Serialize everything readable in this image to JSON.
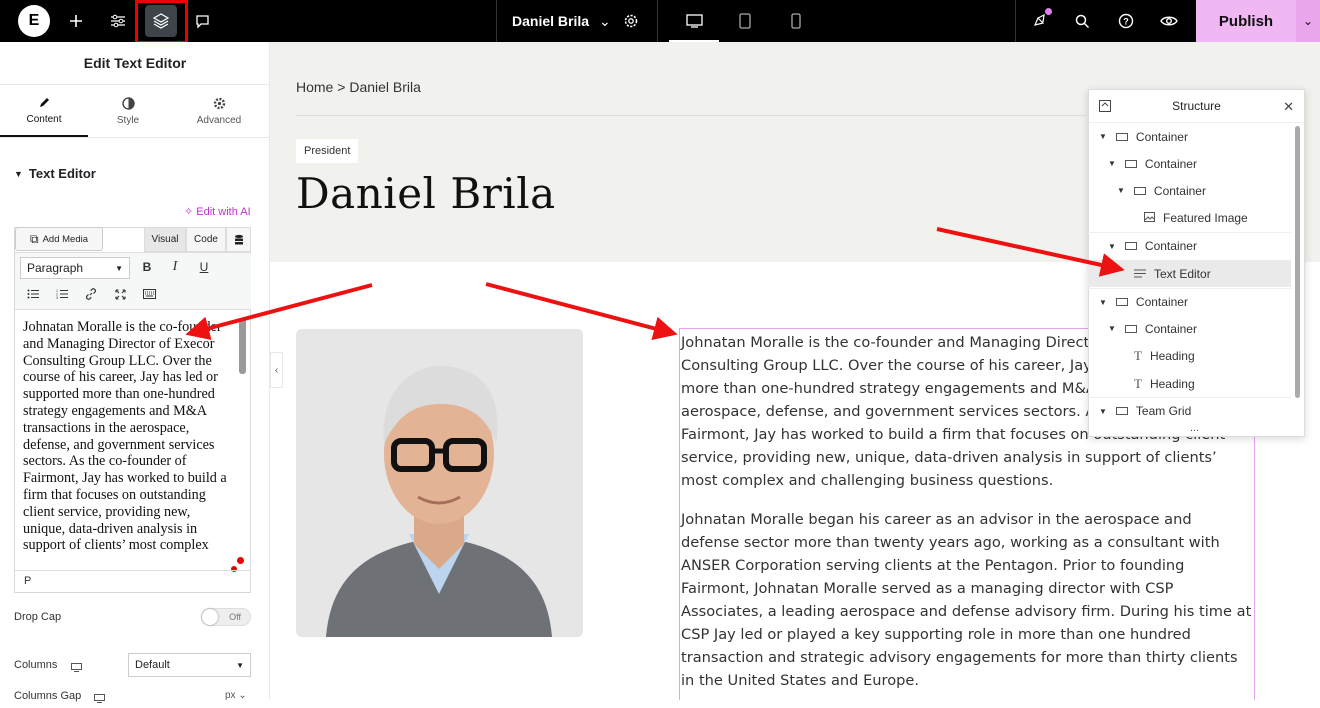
{
  "topbar": {
    "document_name": "Daniel Brila",
    "publish_label": "Publish"
  },
  "panel": {
    "title": "Edit Text Editor",
    "tabs": [
      {
        "label": "Content"
      },
      {
        "label": "Style"
      },
      {
        "label": "Advanced"
      }
    ],
    "section_title": "Text Editor",
    "edit_ai": "Edit with AI",
    "add_media": "Add Media",
    "visual_tab": "Visual",
    "code_tab": "Code",
    "paragraph_format": "Paragraph",
    "editor_text": "Johnatan Moralle is the co-founder and Managing Director of Execor Consulting Group LLC. Over the course of his career, Jay has led or supported more than one-hundred strategy engagements and M&A transactions in the aerospace, defense, and government services sectors. As the co-founder of Fairmont, Jay has worked to build a firm that focuses on outstanding client service, providing new, unique, data-driven analysis in support of clients’ most complex",
    "path_tag": "P",
    "drop_cap_label": "Drop Cap",
    "drop_cap_state": "Off",
    "columns_label": "Columns",
    "columns_value": "Default",
    "columns_gap_label": "Columns Gap",
    "columns_gap_unit": "px"
  },
  "page": {
    "breadcrumb_home": "Home",
    "breadcrumb_sep": ">",
    "breadcrumb_current": "Daniel Brila",
    "badge": "President",
    "name": "Daniel Brila",
    "bio_p1": "Johnatan Moralle is the co-founder and Managing Director of Execor Consulting Group LLC. Over the course of his career, Jay has led or supported more than one-hundred strategy engagements and M&A transactions in the aerospace, defense, and government services sectors. As the co-founder of Fairmont, Jay has worked to build a firm that focuses on outstanding client service, providing new, unique, data-driven analysis in support of clients’ most complex and challenging business questions.",
    "bio_p2": "Johnatan Moralle began his career as an advisor in the aerospace and defense sector more than twenty years ago, working as a consultant with ANSER Corporation serving clients at the Pentagon. Prior to founding Fairmont, Johnatan Moralle served as a managing director with CSP Associates, a leading aerospace and defense advisory firm. During his time at CSP Jay led or played a key supporting role in more than one hundred transaction and strategic advisory engagements for more than thirty clients in the United States and Europe."
  },
  "structure": {
    "title": "Structure",
    "items": [
      {
        "label": "Container",
        "icon": "container-icon"
      },
      {
        "label": "Container",
        "icon": "container-icon"
      },
      {
        "label": "Container",
        "icon": "container-icon"
      },
      {
        "label": "Featured Image",
        "icon": "image-icon"
      },
      {
        "label": "Container",
        "icon": "container-icon"
      },
      {
        "label": "Text Editor",
        "icon": "text-editor-icon"
      },
      {
        "label": "Container",
        "icon": "container-icon"
      },
      {
        "label": "Container",
        "icon": "container-icon"
      },
      {
        "label": "Heading",
        "icon": "heading-icon"
      },
      {
        "label": "Heading",
        "icon": "heading-icon"
      },
      {
        "label": "Team Grid",
        "icon": "container-icon"
      }
    ],
    "more": "..."
  },
  "colors": {
    "publish": "#f0b7f3",
    "annotation": "#ee1111",
    "selection": "#e3a5ea"
  }
}
